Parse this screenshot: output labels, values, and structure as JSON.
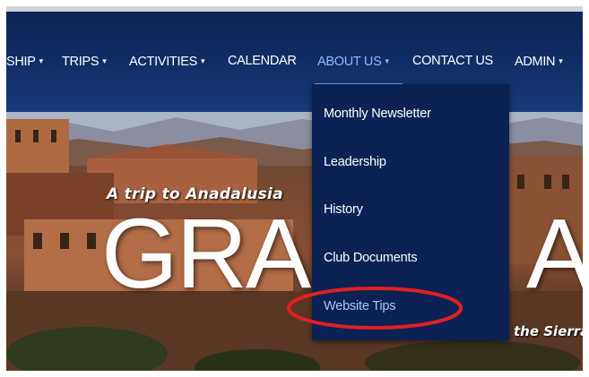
{
  "nav": {
    "items": [
      {
        "label": "SHIP",
        "caret": "▾"
      },
      {
        "label": "TRIPS",
        "caret": "▾"
      },
      {
        "label": "ACTIVITIES",
        "caret": "▾"
      },
      {
        "label": "CALENDAR",
        "caret": ""
      },
      {
        "label": "ABOUT US",
        "caret": "▾"
      },
      {
        "label": "CONTACT US",
        "caret": ""
      },
      {
        "label": "ADMIN",
        "caret": "▾"
      }
    ],
    "active": "ABOUT US"
  },
  "dropdown": {
    "items": [
      {
        "label": "Monthly Newsletter"
      },
      {
        "label": "Leadership"
      },
      {
        "label": "History"
      },
      {
        "label": "Club Documents"
      },
      {
        "label": "Website Tips"
      }
    ],
    "highlighted": "Website Tips"
  },
  "hero": {
    "subtitle": "A trip to Anadalusia",
    "title_left": "GRA",
    "title_right": "A",
    "tagline_tail": "the Sierra"
  },
  "colors": {
    "nav_bg": "#112c64",
    "active_link": "#8fb8ff",
    "dropdown_bg": "#0c2254",
    "annotation_ring": "#e02020"
  }
}
